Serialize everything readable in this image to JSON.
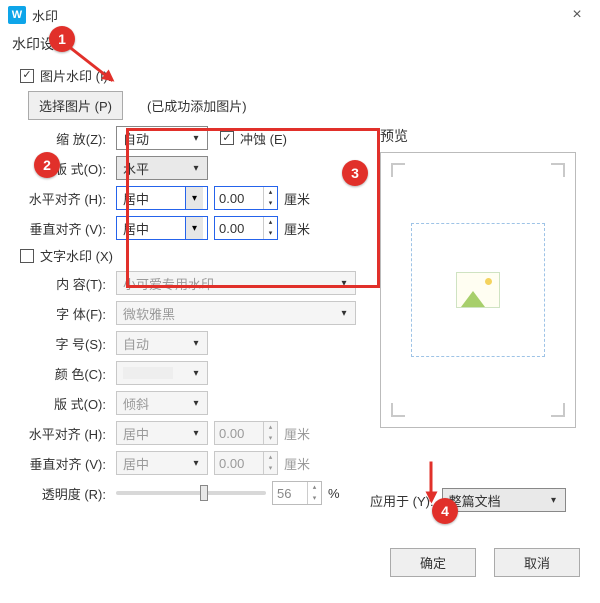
{
  "titlebar": {
    "app_icon_letter": "W",
    "title": "水印",
    "close_glyph": "×"
  },
  "section": {
    "label": "水印设置："
  },
  "image_wm": {
    "checkbox_label": "图片水印 (I):",
    "checked": true,
    "choose_btn": "选择图片 (P)",
    "added_msg": "(已成功添加图片)",
    "scale_label": "缩    放(Z):",
    "scale_value": "自动",
    "erode_checked": true,
    "erode_label": "冲蚀 (E)",
    "layout_label": "版    式(O):",
    "layout_value": "水平",
    "halign_label": "水平对齐 (H):",
    "halign_value": "居中",
    "halign_offset": "0.00",
    "unit": "厘米",
    "valign_label": "垂直对齐 (V):",
    "valign_value": "居中",
    "valign_offset": "0.00"
  },
  "text_wm": {
    "checkbox_label": "文字水印 (X)",
    "checked": false,
    "content_label": "内    容(T):",
    "content_value": "小可爱专用水印",
    "font_label": "字    体(F):",
    "font_value": "微软雅黑",
    "size_label": "字    号(S):",
    "size_value": "自动",
    "color_label": "颜    色(C):",
    "layout_label": "版    式(O):",
    "layout_value": "倾斜",
    "halign_label": "水平对齐 (H):",
    "halign_value": "居中",
    "halign_offset": "0.00",
    "unit": "厘米",
    "valign_label": "垂直对齐 (V):",
    "valign_value": "居中",
    "valign_offset": "0.00",
    "opacity_label": "透明度 (R):",
    "opacity_value": "56",
    "opacity_unit": "%"
  },
  "preview": {
    "title": "预览"
  },
  "apply": {
    "label": "应用于 (Y):",
    "value": "整篇文档"
  },
  "footer": {
    "ok": "确定",
    "cancel": "取消"
  },
  "callouts": {
    "c1": "1",
    "c2": "2",
    "c3": "3",
    "c4": "4"
  }
}
